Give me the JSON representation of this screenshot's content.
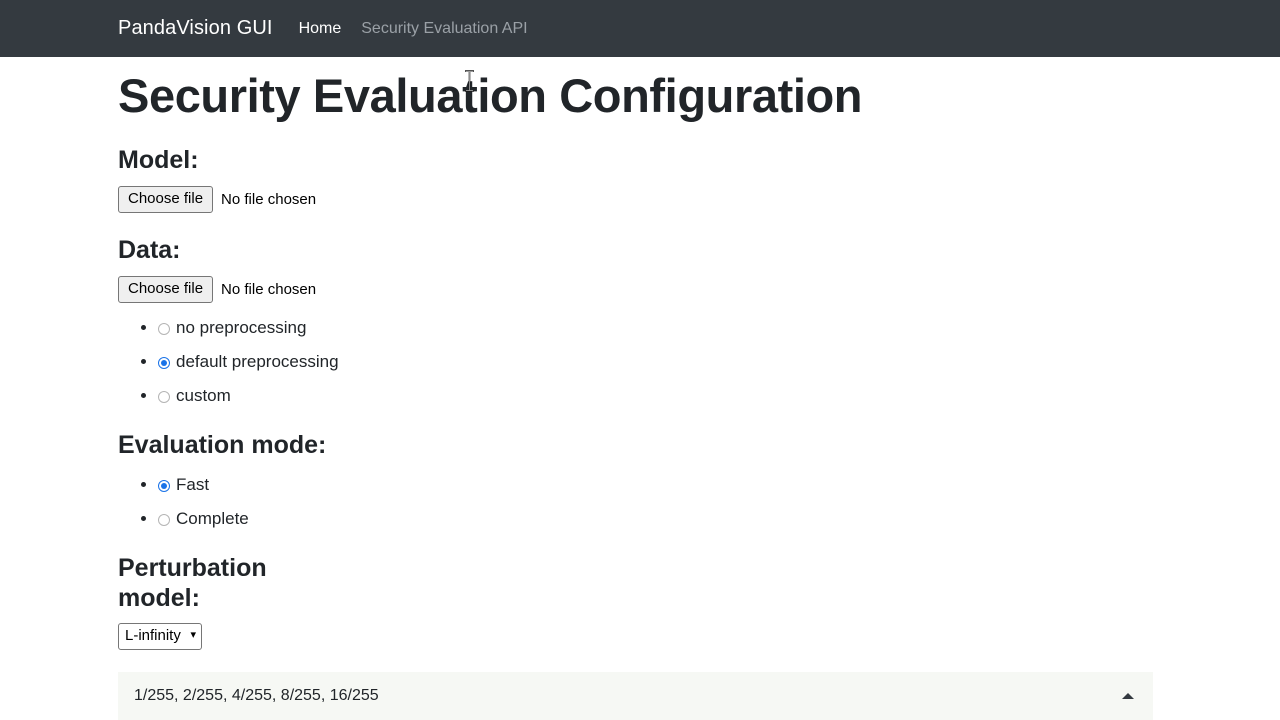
{
  "navbar": {
    "brand": "PandaVision GUI",
    "links": [
      {
        "label": "Home",
        "state": "active"
      },
      {
        "label": "Security Evaluation API",
        "state": "muted"
      }
    ]
  },
  "main": {
    "page_title": "Security Evaluation Configuration",
    "model_section": {
      "heading": "Model:",
      "file_button_label": "Choose file",
      "file_status": "No file chosen"
    },
    "data_section": {
      "heading": "Data:",
      "file_button_label": "Choose file",
      "file_status": "No file chosen",
      "preprocessing_options": [
        {
          "label": "no preprocessing",
          "checked": false
        },
        {
          "label": "default preprocessing",
          "checked": true
        },
        {
          "label": "custom",
          "checked": false
        }
      ]
    },
    "evaluation_mode_section": {
      "heading": "Evaluation mode:",
      "options": [
        {
          "label": "Fast",
          "checked": true
        },
        {
          "label": "Complete",
          "checked": false
        }
      ]
    },
    "perturbation_section": {
      "heading": "Perturbation model:",
      "selected_value": "L-infinity",
      "options": [
        "L-infinity"
      ],
      "chevron_icon": "chevron-down-icon"
    },
    "epsilon_panel": {
      "values": "1/255, 2/255, 4/255, 8/255, 16/255",
      "collapse_icon": "caret-up-icon"
    }
  },
  "colors": {
    "navbar_bg": "#343a40",
    "page_bg": "#ffffff",
    "text": "#212529",
    "muted_link": "#9aa0a6",
    "radio_accent": "#1a73e8",
    "panel_bg": "#f6f8f4",
    "button_bg": "#efefef"
  }
}
